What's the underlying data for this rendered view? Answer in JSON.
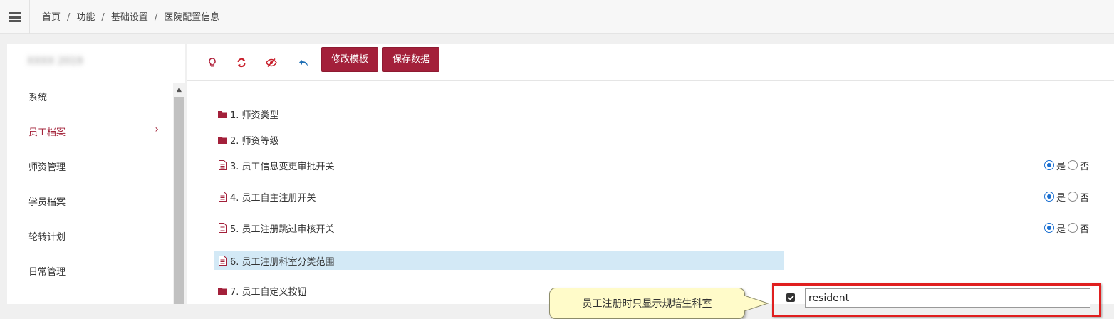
{
  "breadcrumb": [
    "首页",
    "功能",
    "基础设置",
    "医院配置信息"
  ],
  "breadcrumb_separator": "/",
  "sidebar": {
    "blurred_title": "XXXX 2019",
    "items": [
      {
        "label": "系统",
        "active": false
      },
      {
        "label": "员工档案",
        "active": true
      },
      {
        "label": "师资管理",
        "active": false
      },
      {
        "label": "学员档案",
        "active": false
      },
      {
        "label": "轮转计划",
        "active": false
      },
      {
        "label": "日常管理",
        "active": false
      }
    ],
    "active_chevron": "›"
  },
  "toolbar": {
    "icons": [
      "lightbulb-icon",
      "refresh-icon",
      "eye-slash-icon",
      "undo-icon"
    ],
    "edit_template_label": "修改模板",
    "save_data_label": "保存数据"
  },
  "tree": [
    {
      "label": "1. 师资类型",
      "type": "folder"
    },
    {
      "label": "2. 师资等级",
      "type": "folder"
    },
    {
      "label": "3. 员工信息变更审批开关",
      "type": "file",
      "value": "是"
    },
    {
      "label": "4. 员工自主注册开关",
      "type": "file",
      "value": "是"
    },
    {
      "label": "5. 员工注册跳过审核开关",
      "type": "file",
      "value": "是"
    },
    {
      "label": "6. 员工注册科室分类范围",
      "type": "file",
      "selected": true
    },
    {
      "label": "7. 员工自定义按钮",
      "type": "folder"
    }
  ],
  "radio_options": [
    "是",
    "否"
  ],
  "row6": {
    "checkbox_checked": true,
    "input_value": "resident"
  },
  "tooltip": "员工注册时只显示规培生科室",
  "colors": {
    "brand": "#a3203a",
    "selected_row": "#d3e9f6",
    "highlight_border": "#e01f1f",
    "tooltip_bg": "#fffbc9"
  }
}
